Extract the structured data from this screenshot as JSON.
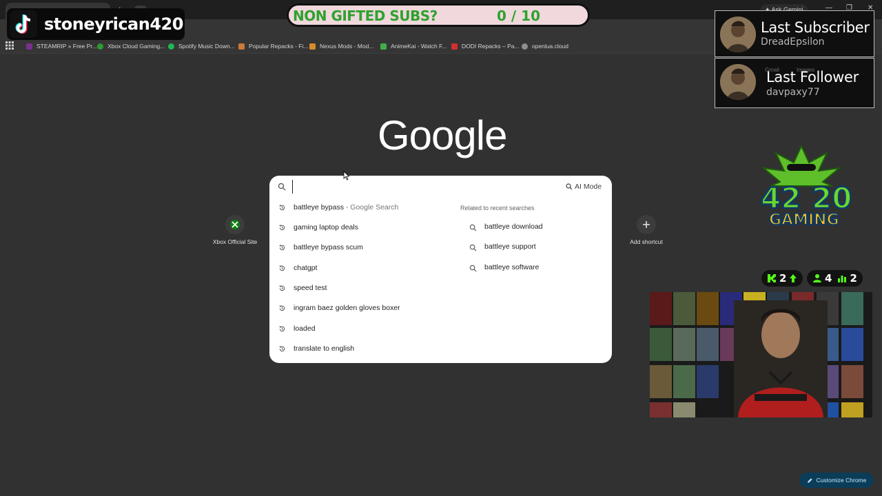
{
  "browser": {
    "ask_gemini": "Ask Gemini",
    "bookmarks": [
      {
        "label": "STEAMRIP » Free Pr...",
        "color": "#7b2f8f"
      },
      {
        "label": "Xbox Cloud Gaming...",
        "color": "#2e9b2e"
      },
      {
        "label": "Spotify Music Down...",
        "color": "#1db954"
      },
      {
        "label": "Popular Repacks - Fi...",
        "color": "#c77a3a"
      },
      {
        "label": "Nexus Mods - Mod...",
        "color": "#d98a2b"
      },
      {
        "label": "AnimeKai - Watch F...",
        "color": "#3fae4a"
      },
      {
        "label": "DODI Repacks – Pa...",
        "color": "#d32f2f"
      },
      {
        "label": "openlua.cloud",
        "color": "#8f8f8f"
      }
    ]
  },
  "google": {
    "logo": "Google",
    "search_value": "",
    "ai_mode_label": "AI Mode",
    "history": [
      {
        "text": "battleye bypass",
        "suffix": " - Google Search"
      },
      {
        "text": "gaming laptop deals",
        "suffix": ""
      },
      {
        "text": "battleye bypass scum",
        "suffix": ""
      },
      {
        "text": "chatgpt",
        "suffix": ""
      },
      {
        "text": "speed test",
        "suffix": ""
      },
      {
        "text": "ingram baez golden gloves boxer",
        "suffix": ""
      },
      {
        "text": "loaded",
        "suffix": ""
      },
      {
        "text": "translate to english",
        "suffix": ""
      }
    ],
    "related_heading": "Related to recent searches",
    "related": [
      "battleye download",
      "battleye support",
      "battleye software"
    ],
    "shortcuts": [
      {
        "label": "Xbox Official Site",
        "icon": "xbox-icon"
      },
      {
        "label": "Add shortcut",
        "icon": "plus-icon"
      }
    ],
    "customize_label": "Customize Chrome"
  },
  "overlay": {
    "tiktok_name": "stoneyrican420",
    "subs_title": "NON GIFTED SUBS?",
    "subs_count": "0 / 10",
    "last_subscriber_title": "Last Subscriber",
    "last_subscriber_name": "DreadEpsilon",
    "last_follower_title": "Last Follower",
    "last_follower_name": "davpaxy77",
    "ghost_gmail": "Gmail",
    "ghost_images": "Images",
    "logo_text_left": "42",
    "logo_text_right": "20",
    "logo_text_bottom": "GAMING",
    "stat_kick": "2",
    "stat_followers": "4",
    "stat_viewers": "2",
    "accent_green": "#2fa12f"
  }
}
